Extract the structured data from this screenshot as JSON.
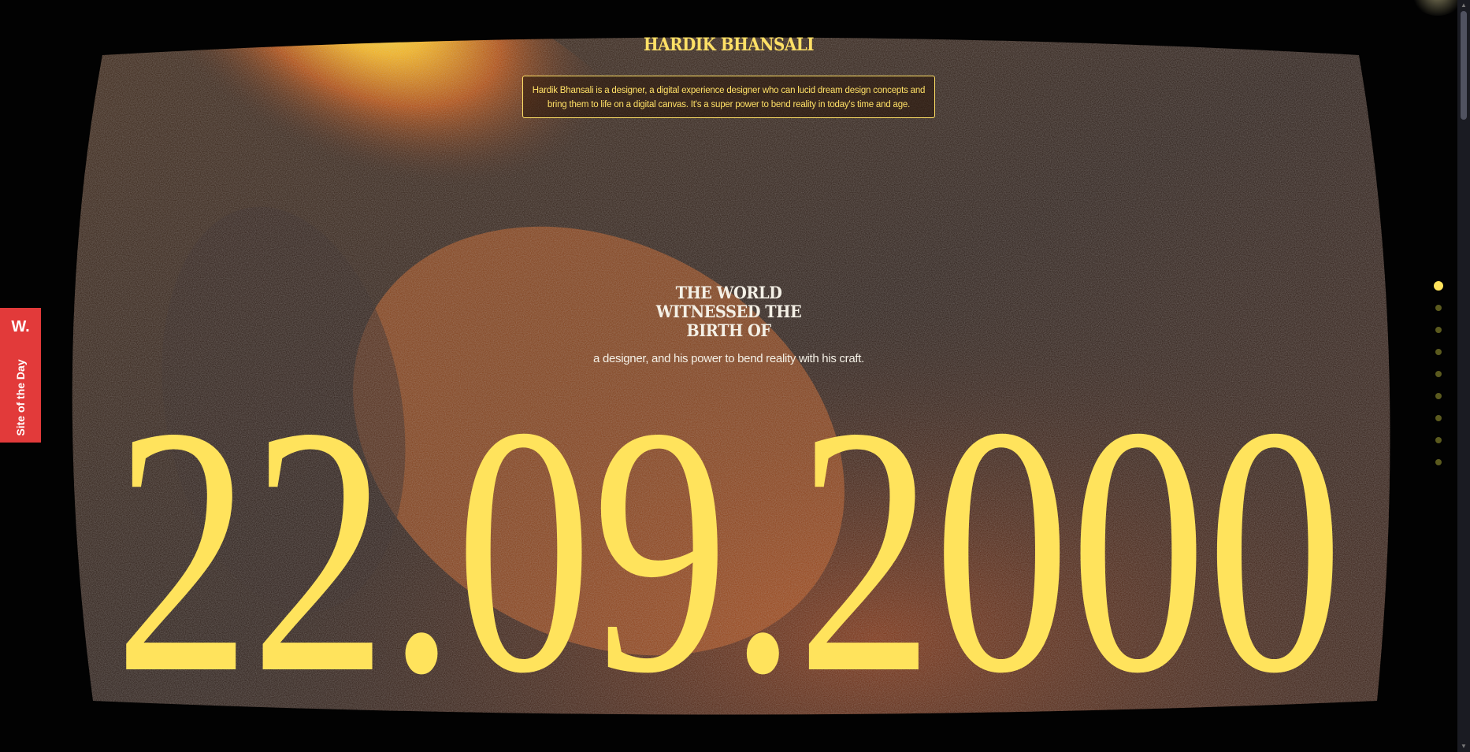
{
  "site": {
    "title": "HARDIK BHANSALI",
    "bio": "Hardik Bhansali is a designer, a digital experience designer who can lucid dream design concepts and bring them to life on a digital canvas. It's a super power to bend reality in today's time and age."
  },
  "hero": {
    "headline_lines": [
      "THE WORLD",
      "WITNESSED THE",
      "BIRTH OF"
    ],
    "subline": "a designer, and his power to bend reality with his craft.",
    "date": "22.09.2000"
  },
  "badge": {
    "logo": "W.",
    "label": "Site of the Day"
  },
  "pagination": {
    "count": 9,
    "active_index": 0
  },
  "colors": {
    "accent": "#ffe35c",
    "badge_red": "#e23a3a",
    "background": "#020202"
  },
  "icons": {
    "scroll_up": "triangle-up",
    "scroll_down": "triangle-down"
  }
}
